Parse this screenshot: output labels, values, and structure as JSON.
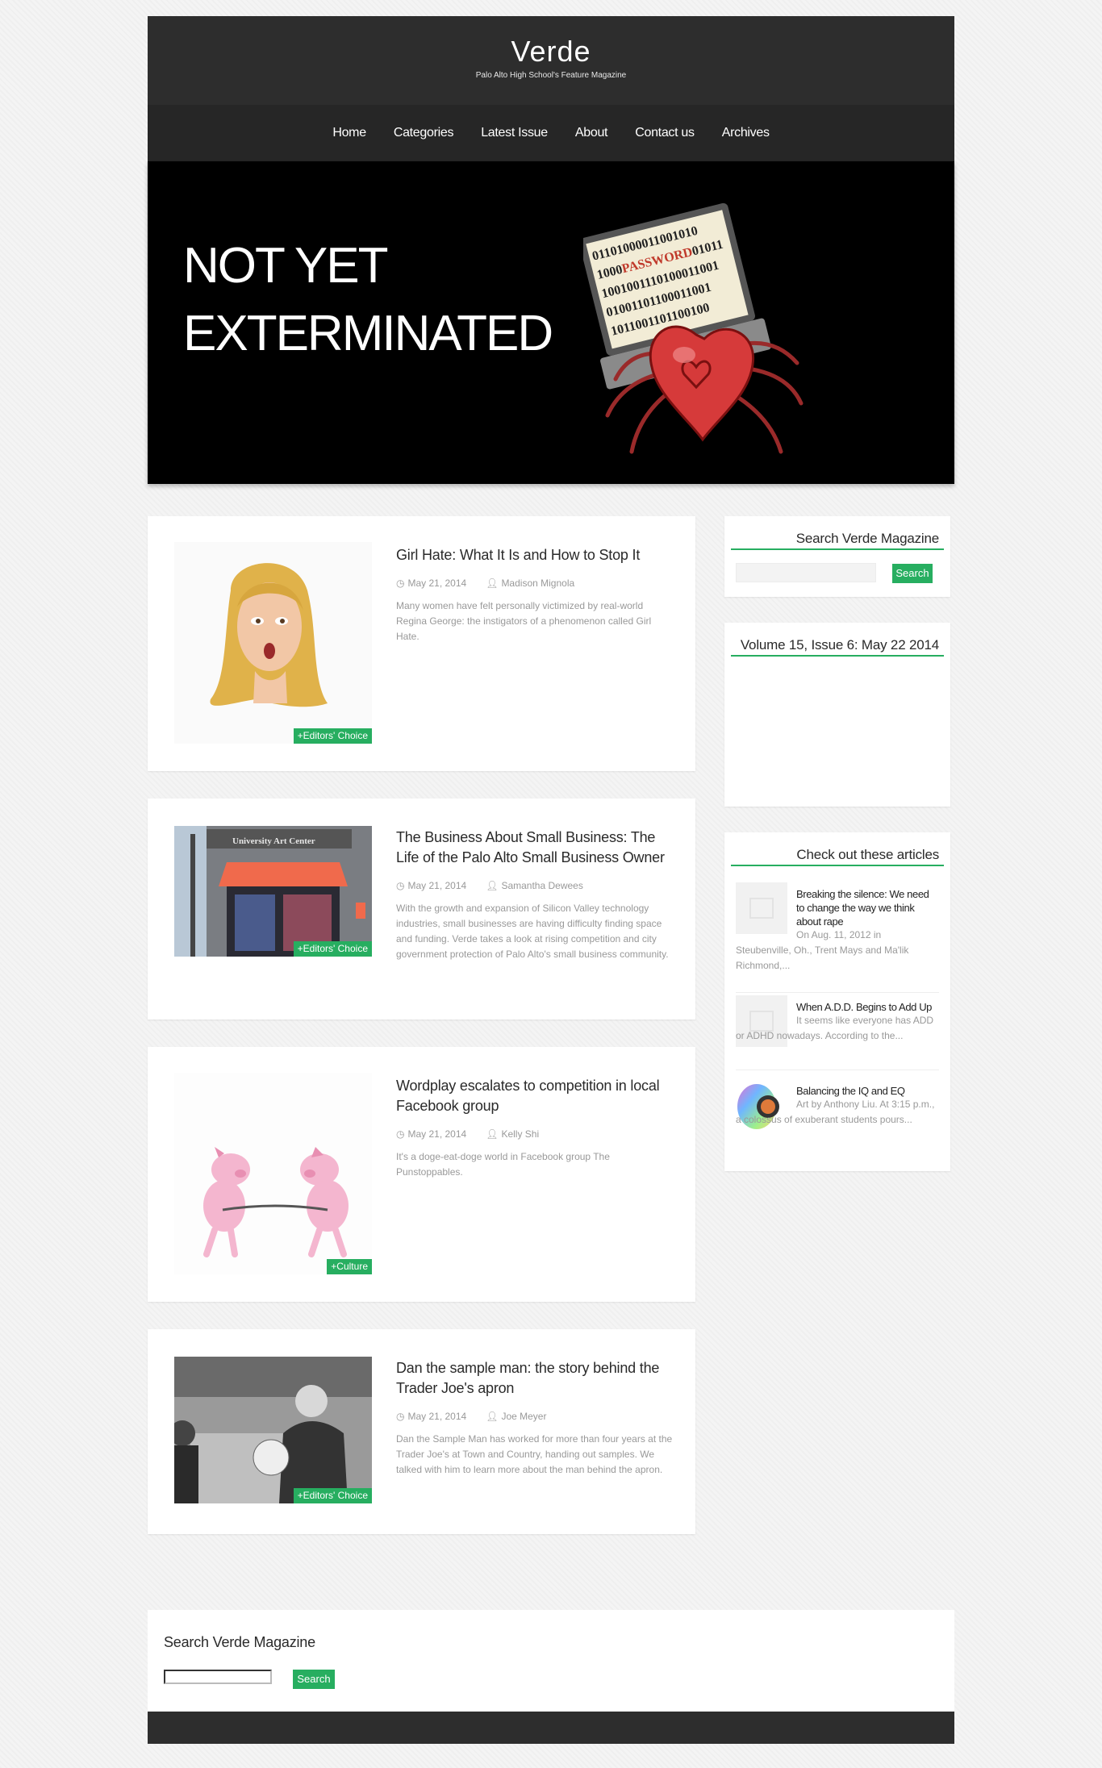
{
  "site": {
    "title": "Verde",
    "tagline": "Palo Alto High School's Feature Magazine"
  },
  "nav": {
    "items": [
      "Home",
      "Categories",
      "Latest Issue",
      "About",
      "Contact us",
      "Archives"
    ]
  },
  "hero": {
    "title": "NOT YET EXTERMINATED",
    "art_lines": [
      "01101000011001010",
      "1000PASSWORD01011",
      "1001001110100011001",
      "01001101100011001",
      "1011001101100100"
    ]
  },
  "articles": [
    {
      "title": "Girl Hate: What It Is and How to Stop It",
      "date": "May 21, 2014",
      "author": "Madison Mignola",
      "excerpt": "Many women have felt personally victimized by real-world Regina George: the instigators of a phenomenon called Girl Hate.",
      "tag": "+Editors' Choice"
    },
    {
      "title": "The Business About Small Business: The Life of the Palo Alto Small Business Owner",
      "date": "May 21, 2014",
      "author": "Samantha Dewees",
      "excerpt": "With the growth and expansion of Silicon Valley technology industries, small businesses are having difficulty finding space and funding. Verde takes a look at rising competition and city government protection of Palo Alto's small business community.",
      "tag": "+Editors' Choice",
      "image_sign": "University Art Center"
    },
    {
      "title": "Wordplay escalates to competition in local Facebook group",
      "date": "May 21, 2014",
      "author": "Kelly Shi",
      "excerpt": "It's a doge-eat-doge world in Facebook group The Punstoppables.",
      "tag": "+Culture"
    },
    {
      "title": "Dan the sample man: the story behind the Trader Joe's apron",
      "date": "May 21, 2014",
      "author": "Joe Meyer",
      "excerpt": "Dan the Sample Man has worked for more than four years at the Trader Joe's at Town and Country, handing out samples. We talked with him to learn more about the man behind the apron.",
      "tag": "+Editors' Choice"
    }
  ],
  "sidebar": {
    "search": {
      "title": "Search Verde Magazine",
      "button": "Search",
      "placeholder": ""
    },
    "issue": {
      "title": "Volume 15, Issue 6: May 22 2014"
    },
    "featured": {
      "title": "Check out these articles",
      "items": [
        {
          "title": "Breaking the silence: We need to change the way we think about rape",
          "excerpt": "On Aug. 11, 2012 in Steubenville, Oh., Trent Mays and Ma'lik Richmond,..."
        },
        {
          "title": "When A.D.D. Begins to Add Up",
          "excerpt": "It seems like everyone has ADD or ADHD nowadays. According to the..."
        },
        {
          "title": "Balancing the IQ and EQ",
          "excerpt": "Art by Anthony Liu. At 3:15 p.m., a colossus of exuberant students pours..."
        }
      ]
    }
  },
  "footer": {
    "search": {
      "title": "Search Verde Magazine",
      "button": "Search",
      "placeholder": ""
    }
  },
  "colors": {
    "accent": "#27ae60",
    "header_bg": "#2d2d2d",
    "nav_bg": "#262626",
    "hero_bg": "#000000"
  }
}
